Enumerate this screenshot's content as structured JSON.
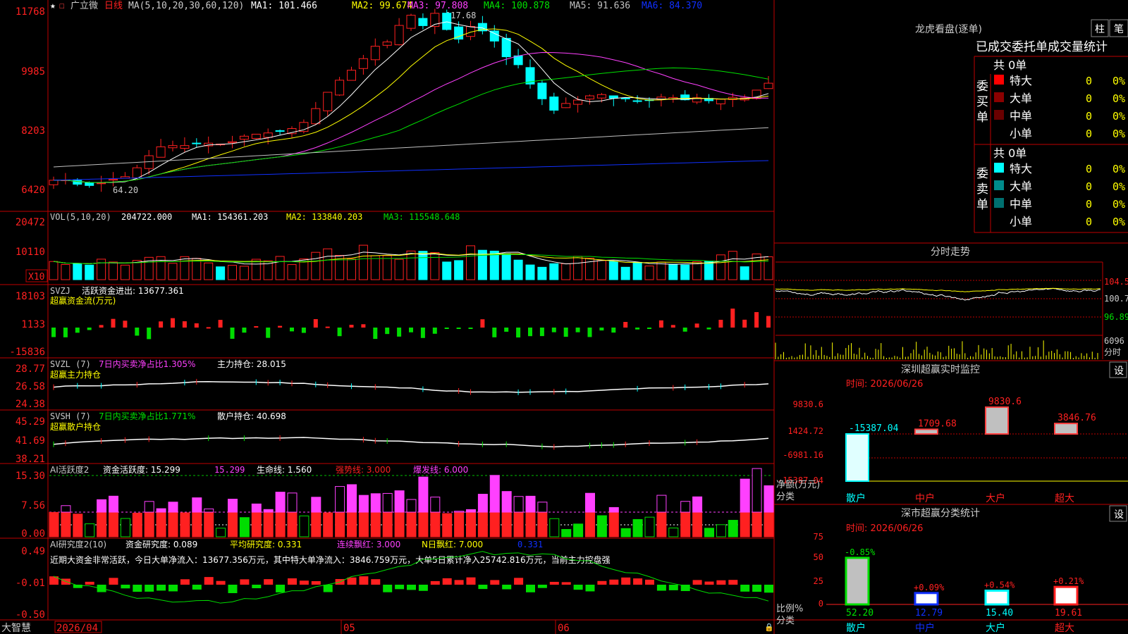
{
  "colors": {
    "up": "#ff2020",
    "down": "#00ffff",
    "border": "#c00000",
    "yellow": "#ffff00",
    "white": "#ffffff",
    "magenta": "#ff40ff",
    "green": "#00e000",
    "blue": "#1030ff",
    "grey": "#c0c0c0"
  },
  "kline": {
    "title": "广立微",
    "period": "日线",
    "ma_label": "MA(5,10,20,30,60,120)",
    "ma1": "MA1: 101.466",
    "ma2": "MA2: 99.674",
    "ma3": "MA3: 97.808",
    "ma4": "MA4: 100.878",
    "ma5": "MA5: 91.636",
    "ma6": "MA6: 84.370",
    "arrow": "↑",
    "high_label": "117.68",
    "low_label": "64.20",
    "axis": [
      "11768",
      "9985",
      "8203",
      "6420"
    ]
  },
  "vol": {
    "header": "VOL(5,10,20)",
    "value": "204722.000",
    "ma1": "MA1: 154361.203",
    "ma2": "MA2: 133840.203",
    "ma3": "MA3: 115548.648",
    "axis": [
      "20472",
      "10110"
    ],
    "unit": "X10"
  },
  "svzj": {
    "header": "SVZJ",
    "label1": "活跃资金进出: 13677.361",
    "label2": "超赢资金流(万元)",
    "axis": [
      "18103",
      "1133",
      "-15836"
    ]
  },
  "svzl": {
    "header": "SVZL (7)",
    "label1": "7日内买卖净占比1.305%",
    "label2": "主力持仓: 28.015",
    "label3": "超赢主力持仓",
    "axis": [
      "28.77",
      "26.58",
      "24.38"
    ]
  },
  "svsh": {
    "header": "SVSH (7)",
    "label1": "7日内买卖净占比1.771%",
    "label2": "散户持仓: 40.698",
    "label3": "超赢散户持仓",
    "axis": [
      "45.29",
      "41.69",
      "38.21"
    ]
  },
  "ai1": {
    "header": "AI活跃度2",
    "label1": "资金活跃度: 15.299",
    "label2": "15.299",
    "label3": "生命线: 1.560",
    "label4": "强势线: 3.000",
    "label5": "爆发线: 6.000",
    "axis": [
      "15.30",
      "7.56",
      "0.00"
    ]
  },
  "ai2": {
    "header": "AI研究度2(10)",
    "label1": "资金研究度: 0.089",
    "label2": "平均研究度: 0.331",
    "label3": "连续飘红: 3.000",
    "label4": "N日飘红: 7.000",
    "label5": "0.331",
    "note": "近期大资金非常活跃，今日大单净流入：13677.356万元，其中特大单净流入：3846.759万元，大单5日累计净入25742.816万元，当前主力控盘强",
    "axis": [
      "0.49",
      "-0.01",
      "-0.50"
    ]
  },
  "bottom": {
    "brand": "大智慧",
    "date": "2026/04",
    "m05": "05",
    "m06": "06"
  },
  "longhu": {
    "title": "龙虎看盘(逐单)",
    "btn_zhu": "柱",
    "btn_bi": "笔",
    "header": "已成交委托单成交量统计",
    "buy_title": "委买单",
    "sell_title": "委卖单",
    "buy_total": "共 0单",
    "sell_total": "共 0单",
    "rows": [
      {
        "label": "特大",
        "count": "0",
        "pct": "0%"
      },
      {
        "label": "大单",
        "count": "0",
        "pct": "0%"
      },
      {
        "label": "中单",
        "count": "0",
        "pct": "0%"
      },
      {
        "label": "小单",
        "count": "0",
        "pct": "0%"
      }
    ]
  },
  "intraday": {
    "title": "分时走势",
    "price_labels": [
      "104.5",
      "100.7",
      "96.89"
    ],
    "vol_label": "6096",
    "vol_unit": "分时"
  },
  "monitor": {
    "title": "深圳超赢实时监控",
    "btn": "设",
    "date": "时间: 2026/06/26",
    "axis": [
      "9830.6",
      "1424.72",
      "-6981.16",
      "-15387.04"
    ],
    "ylabel": "净额(万元)",
    "xlabel": "分类",
    "bars": [
      {
        "cat": "散户",
        "value": -15387.04,
        "label": "-15387.04"
      },
      {
        "cat": "中户",
        "value": 1709.68,
        "label": "1709.68"
      },
      {
        "cat": "大户",
        "value": 9830.6,
        "label": "9830.6"
      },
      {
        "cat": "超大",
        "value": 3846.76,
        "label": "3846.76"
      }
    ]
  },
  "classify": {
    "title": "深市超赢分类统计",
    "btn": "设",
    "date": "时间: 2026/06/26",
    "axis": [
      "75",
      "50",
      "25",
      "0"
    ],
    "ylabel": "比例%",
    "xlabel": "分类",
    "bars": [
      {
        "cat": "散户",
        "value": 52.2,
        "label": "52.20",
        "chg": "-0.85%"
      },
      {
        "cat": "中户",
        "value": 12.79,
        "label": "12.79",
        "chg": "+0.09%"
      },
      {
        "cat": "大户",
        "value": 15.4,
        "label": "15.40",
        "chg": "+0.54%"
      },
      {
        "cat": "超大",
        "value": 19.61,
        "label": "19.61",
        "chg": "+0.21%"
      }
    ]
  }
}
